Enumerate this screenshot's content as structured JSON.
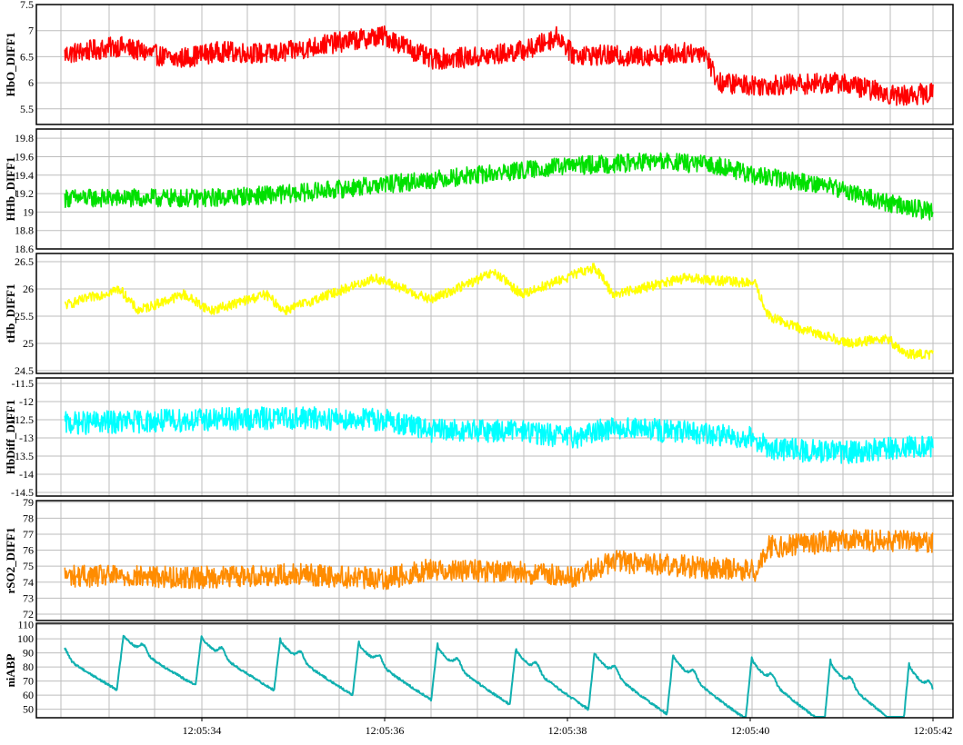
{
  "chart_data": [
    {
      "type": "line",
      "ylabel": "HbO_DIFF1",
      "color": "#ff0000",
      "ylim": [
        5.2,
        7.5
      ],
      "yticks": [
        "7.5",
        "7",
        "6.5",
        "6",
        "5.5"
      ],
      "ytick_values": [
        7.5,
        7,
        6.5,
        6,
        5.5
      ],
      "series": [
        {
          "knots": [
            [
              0,
              6.55
            ],
            [
              0.6,
              6.7
            ],
            [
              1.2,
              6.45
            ],
            [
              1.7,
              6.6
            ],
            [
              2.3,
              6.55
            ],
            [
              2.9,
              6.75
            ],
            [
              3.5,
              6.9
            ],
            [
              4.0,
              6.45
            ],
            [
              4.6,
              6.5
            ],
            [
              5.1,
              6.65
            ],
            [
              5.4,
              6.9
            ],
            [
              5.55,
              6.55
            ],
            [
              6.2,
              6.5
            ],
            [
              7.0,
              6.6
            ],
            [
              7.15,
              6.0
            ],
            [
              7.6,
              5.95
            ],
            [
              8.5,
              6.0
            ],
            [
              9.1,
              5.75
            ],
            [
              9.5,
              5.8
            ]
          ],
          "noise": 0.2
        }
      ]
    },
    {
      "type": "line",
      "ylabel": "HHb_DIFF1",
      "color": "#00e000",
      "ylim": [
        18.6,
        19.9
      ],
      "yticks": [
        "19.8",
        "19.6",
        "19.4",
        "19.2",
        "19",
        "18.8",
        "18.6"
      ],
      "ytick_values": [
        19.8,
        19.6,
        19.4,
        19.2,
        19,
        18.8,
        18.6
      ],
      "series": [
        {
          "knots": [
            [
              0,
              19.15
            ],
            [
              1.5,
              19.15
            ],
            [
              2.5,
              19.2
            ],
            [
              3.5,
              19.3
            ],
            [
              4.5,
              19.4
            ],
            [
              5.5,
              19.5
            ],
            [
              6.5,
              19.55
            ],
            [
              7.2,
              19.5
            ],
            [
              7.5,
              19.4
            ],
            [
              8.3,
              19.3
            ],
            [
              9.0,
              19.1
            ],
            [
              9.5,
              19.0
            ]
          ],
          "noise": 0.1
        }
      ]
    },
    {
      "type": "line",
      "ylabel": "tHb_DIFF1",
      "color": "#ffff00",
      "ylim": [
        24.45,
        26.65
      ],
      "yticks": [
        "26.5",
        "26",
        "25.5",
        "25",
        "24.5"
      ],
      "ytick_values": [
        26.5,
        26,
        25.5,
        25,
        24.5
      ],
      "series": [
        {
          "knots": [
            [
              0,
              25.7
            ],
            [
              0.6,
              26.0
            ],
            [
              0.8,
              25.6
            ],
            [
              1.3,
              25.9
            ],
            [
              1.6,
              25.6
            ],
            [
              2.2,
              25.9
            ],
            [
              2.4,
              25.6
            ],
            [
              2.9,
              25.9
            ],
            [
              3.4,
              26.2
            ],
            [
              4.0,
              25.8
            ],
            [
              4.7,
              26.3
            ],
            [
              5.0,
              25.9
            ],
            [
              5.8,
              26.4
            ],
            [
              6.0,
              25.9
            ],
            [
              6.8,
              26.2
            ],
            [
              7.55,
              26.1
            ],
            [
              7.7,
              25.5
            ],
            [
              8.0,
              25.3
            ],
            [
              8.6,
              25.0
            ],
            [
              9.0,
              25.1
            ],
            [
              9.2,
              24.8
            ],
            [
              9.5,
              24.8
            ]
          ],
          "noise": 0.09
        }
      ]
    },
    {
      "type": "line",
      "ylabel": "HbDiff_DIFF1",
      "color": "#00ffff",
      "ylim": [
        -14.6,
        -11.35
      ],
      "yticks": [
        "-11.5",
        "-12",
        "-12.5",
        "-13",
        "-13.5",
        "-14",
        "-14.5"
      ],
      "ytick_values": [
        -11.5,
        -12,
        -12.5,
        -13,
        -13.5,
        -14,
        -14.5
      ],
      "series": [
        {
          "knots": [
            [
              0,
              -12.6
            ],
            [
              1.5,
              -12.5
            ],
            [
              2.5,
              -12.45
            ],
            [
              3.5,
              -12.5
            ],
            [
              4.0,
              -12.8
            ],
            [
              5.0,
              -12.8
            ],
            [
              5.55,
              -13.0
            ],
            [
              6.0,
              -12.7
            ],
            [
              7.55,
              -13.0
            ],
            [
              7.7,
              -13.3
            ],
            [
              8.5,
              -13.4
            ],
            [
              9.5,
              -13.2
            ]
          ],
          "noise": 0.32
        }
      ]
    },
    {
      "type": "line",
      "ylabel": "rSO2_DIFF1",
      "color": "#ff8c00",
      "ylim": [
        71.6,
        79.1
      ],
      "yticks": [
        "79",
        "78",
        "77",
        "76",
        "75",
        "74",
        "73",
        "72"
      ],
      "ytick_values": [
        79,
        78,
        77,
        76,
        75,
        74,
        73,
        72
      ],
      "series": [
        {
          "knots": [
            [
              0,
              74.4
            ],
            [
              1.5,
              74.3
            ],
            [
              2.5,
              74.5
            ],
            [
              3.5,
              74.2
            ],
            [
              4.0,
              74.8
            ],
            [
              5.0,
              74.6
            ],
            [
              5.55,
              74.3
            ],
            [
              6.0,
              75.3
            ],
            [
              7.55,
              74.7
            ],
            [
              7.7,
              76.2
            ],
            [
              8.5,
              76.6
            ],
            [
              9.5,
              76.5
            ]
          ],
          "noise": 0.7
        }
      ]
    },
    {
      "type": "line",
      "ylabel": "niABP",
      "color": "#10b0b0",
      "ylim": [
        44,
        111
      ],
      "yticks": [
        "110",
        "100",
        "90",
        "80",
        "70",
        "60",
        "50"
      ],
      "ytick_values": [
        110,
        100,
        90,
        80,
        70,
        60,
        50
      ],
      "series": [
        {
          "pulse": {
            "first_peak_x": 0.64,
            "period": 0.86,
            "end_x": 9.5
          }
        }
      ],
      "x_range": [
        0,
        9.5
      ],
      "xticks": [
        "12:05:34",
        "12:05:36",
        "12:05:38",
        "12:05:40",
        "12:05:42"
      ],
      "xtick_values": [
        1.5,
        3.5,
        5.5,
        7.5,
        9.5
      ]
    }
  ]
}
